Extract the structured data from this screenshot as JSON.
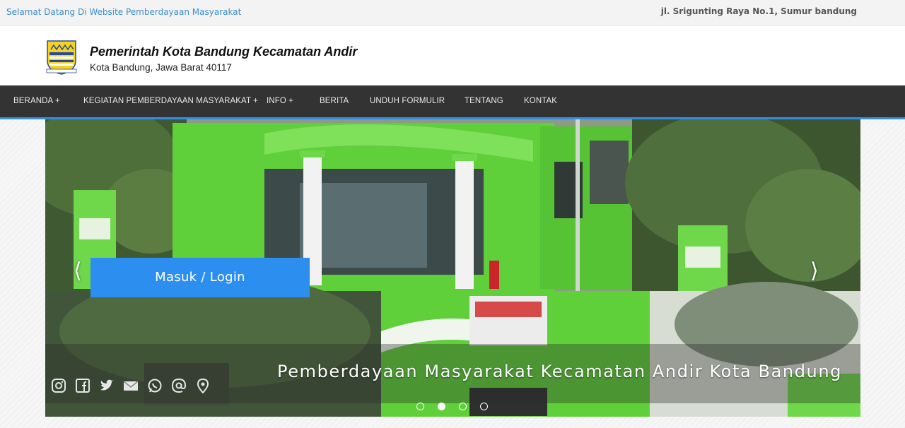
{
  "topbar": {
    "welcome": "Selamat Datang Di Website Pemberdayaan Masyarakat",
    "address": "jl. Srigunting Raya No.1, Sumur bandung"
  },
  "header": {
    "title": "Pemerintah Kota Bandung Kecamatan Andir",
    "subtitle": "Kota Bandung, Jawa Barat 40117",
    "logo_icon": "bandung-city-emblem-icon"
  },
  "nav": {
    "items": [
      "BERANDA +",
      "KEGIATAN PEMBERDAYAAN MASYARAKAT +",
      "INFO +",
      "BERITA",
      "UNDUH FORMULIR",
      "TENTANG",
      "KONTAK"
    ]
  },
  "slider": {
    "prev_arrow": "⟨",
    "next_arrow": "⟩",
    "login_label": "Masuk / Login",
    "caption": "Pemberdayaan Masyarakat Kecamatan Andir Kota Bandung",
    "social_icons": [
      "instagram-icon",
      "facebook-icon",
      "twitter-icon",
      "email-icon",
      "whatsapp-icon",
      "at-icon",
      "location-pin-icon"
    ],
    "active_dot": 2,
    "dot_count": 4
  },
  "colors": {
    "accent": "#2c8ff0",
    "nav_bg": "#333333",
    "welcome_text": "#3b8ed0",
    "building_green": "#5fcf3a"
  }
}
